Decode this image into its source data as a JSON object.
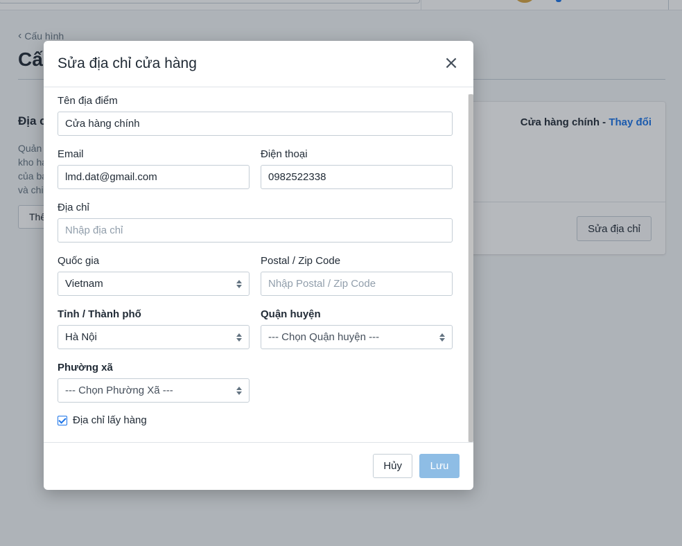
{
  "page": {
    "back_label": "Cấu hình",
    "title": "Cấu",
    "section_heading": "Địa c",
    "section_desc": [
      "Quản",
      "kho ha",
      "của ba",
      "và chi"
    ],
    "add_button": "Thê",
    "card": {
      "store_name": "Cửa hàng chính - ",
      "change_link": "Thay đổi",
      "edit_button": "Sửa địa chỉ"
    }
  },
  "modal": {
    "title": "Sửa địa chỉ cửa hàng",
    "close_glyph": "×",
    "fields": {
      "location_name": {
        "label": "Tên địa điểm",
        "value": "Cửa hàng chính"
      },
      "email": {
        "label": "Email",
        "value": "lmd.dat@gmail.com"
      },
      "phone": {
        "label": "Điện thoại",
        "value": "0982522338"
      },
      "address": {
        "label": "Địa chỉ",
        "placeholder": "Nhập địa chỉ"
      },
      "country": {
        "label": "Quốc gia",
        "value": "Vietnam"
      },
      "postal": {
        "label": "Postal / Zip Code",
        "placeholder": "Nhập Postal / Zip Code"
      },
      "province": {
        "label": "Tỉnh / Thành phố",
        "value": "Hà Nội"
      },
      "district": {
        "label": "Quận huyện",
        "value": "--- Chọn Quận huyện ---"
      },
      "ward": {
        "label": "Phường xã",
        "value": "--- Chọn Phường Xã ---"
      }
    },
    "pickup_checkbox": {
      "label": "Địa chỉ lấy hàng",
      "checked": true
    },
    "cancel_button": "Hủy",
    "save_button": "Lưu"
  },
  "colors": {
    "accent": "#1a73e8",
    "save_disabled": "#8ebde5",
    "overlay": "rgba(33,43,54,0.33)"
  }
}
